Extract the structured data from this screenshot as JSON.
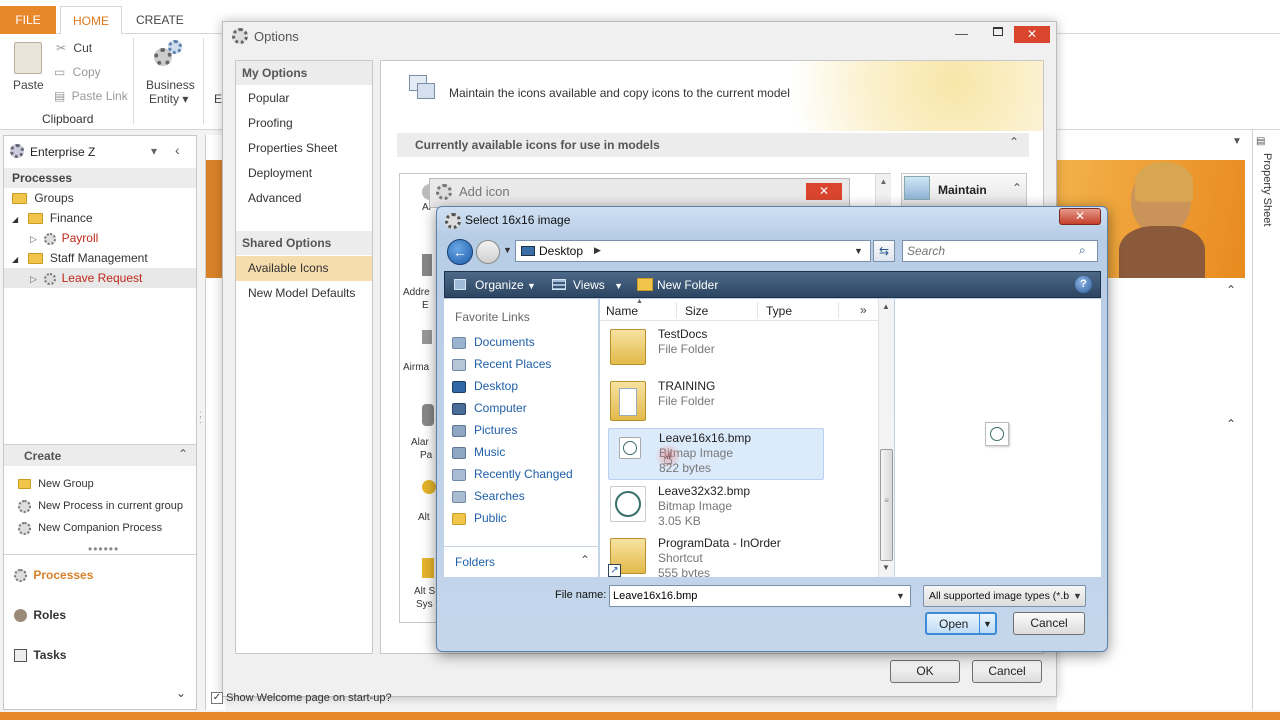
{
  "ribbon": {
    "tabs": [
      "FILE",
      "HOME",
      "CREATE"
    ],
    "paste": "Paste",
    "cut": "Cut",
    "copy": "Copy",
    "paste_link": "Paste Link",
    "clipboard_group": "Clipboard",
    "business_entity": "Business",
    "business_entity2": "Entity",
    "truncated_label": "E"
  },
  "left_pane": {
    "title": "Enterprise Z",
    "section": "Processes",
    "tree": [
      "Groups",
      "Finance",
      "Payroll",
      "Staff Management",
      "Leave Request"
    ],
    "create_header": "Create",
    "create_items": [
      "New Group",
      "New Process in current group",
      "New Companion Process"
    ],
    "nav": [
      "Processes",
      "Roles",
      "Tasks"
    ]
  },
  "property_sheet_label": "Property Sheet",
  "options": {
    "title": "Options",
    "my_options_header": "My Options",
    "my_options": [
      "Popular",
      "Proofing",
      "Properties Sheet",
      "Deployment",
      "Advanced"
    ],
    "shared_options_header": "Shared Options",
    "shared_options": [
      "Available Icons",
      "New Model Defaults"
    ],
    "description": "Maintain the icons available and copy icons to the current model",
    "section_header": "Currently available icons for use in models",
    "maintain_label": "Maintain",
    "partial_labels": [
      "Al",
      "Addre",
      "E",
      "Airma",
      "Alar",
      "Pa",
      "Alt",
      "Alt S",
      "Sys"
    ],
    "ok": "OK",
    "cancel": "Cancel",
    "welcome_checkbox": "Show Welcome page on start-up?"
  },
  "add_icon": {
    "title": "Add icon"
  },
  "file_dialog": {
    "title": "Select 16x16 image",
    "location": "Desktop",
    "search_placeholder": "Search",
    "toolbar": {
      "organize": "Organize",
      "views": "Views",
      "new_folder": "New Folder"
    },
    "favorite_links_header": "Favorite Links",
    "favorites": [
      "Documents",
      "Recent Places",
      "Desktop",
      "Computer",
      "Pictures",
      "Music",
      "Recently Changed",
      "Searches",
      "Public"
    ],
    "folders_label": "Folders",
    "columns": [
      "Name",
      "Size",
      "Type"
    ],
    "files": [
      {
        "name": "TestDocs",
        "type": "File Folder",
        "size": ""
      },
      {
        "name": "TRAINING",
        "type": "File Folder",
        "size": ""
      },
      {
        "name": "Leave16x16.bmp",
        "type": "Bitmap Image",
        "size": "822 bytes"
      },
      {
        "name": "Leave32x32.bmp",
        "type": "Bitmap Image",
        "size": "3.05 KB"
      },
      {
        "name": "ProgramData - InOrder",
        "type": "Shortcut",
        "size": "555 bytes"
      }
    ],
    "file_name_label": "File name:",
    "file_name_value": "Leave16x16.bmp",
    "file_type_filter": "All supported image types (*.b",
    "open": "Open",
    "cancel": "Cancel"
  },
  "colors": {
    "accent_orange": "#d9822b",
    "selected_nav": "#f7dcae",
    "link_blue": "#1f5fa8",
    "tree_red": "#c0281b"
  }
}
